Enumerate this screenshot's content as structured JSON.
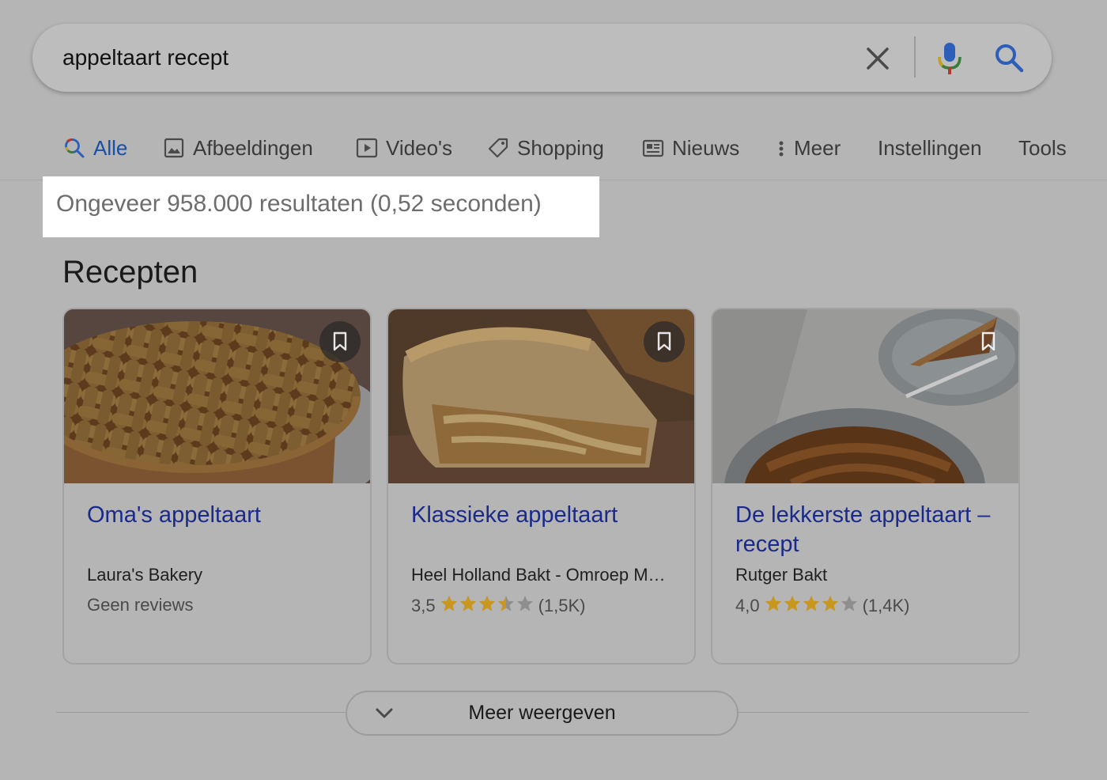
{
  "search": {
    "query": "appeltaart recept"
  },
  "tabs": [
    {
      "label": "Alle",
      "icon": "search-icon",
      "active": true
    },
    {
      "label": "Afbeeldingen",
      "icon": "image-icon"
    },
    {
      "label": "Video's",
      "icon": "video-icon"
    },
    {
      "label": "Shopping",
      "icon": "tag-icon"
    },
    {
      "label": "Nieuws",
      "icon": "news-icon"
    },
    {
      "label": "Meer",
      "icon": "more-vert-icon"
    },
    {
      "label": "Instellingen"
    },
    {
      "label": "Tools"
    }
  ],
  "results_stats": "Ongeveer 958.000 resultaten (0,52 seconden)",
  "section_title": "Recepten",
  "recipes": [
    {
      "title": "Oma's appeltaart",
      "source": "Laura's Bakery",
      "reviews_text": "Geen reviews"
    },
    {
      "title": "Klassieke appeltaart",
      "source": "Heel Holland Bakt - Omroep M…",
      "rating": "3,5",
      "rating_value": 3.5,
      "count": "(1,5K)"
    },
    {
      "title": "De lekkerste appeltaart – recept",
      "source": "Rutger Bakt",
      "rating": "4,0",
      "rating_value": 4.0,
      "count": "(1,4K)"
    }
  ],
  "show_more": "Meer weergeven",
  "colors": {
    "link": "#1a2a8a",
    "active_tab": "#1a4fa8",
    "star": "#c9961e",
    "overlay_bg": "#b5b5b5"
  }
}
